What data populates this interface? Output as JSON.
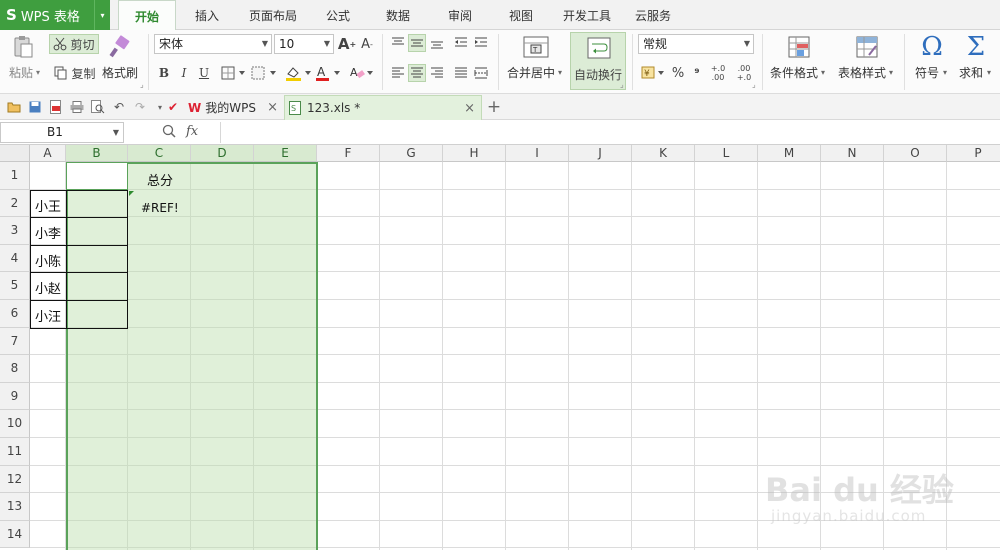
{
  "app": {
    "logo": "S",
    "name": "WPS 表格",
    "drop": "▾"
  },
  "menu_tabs": [
    {
      "label": "开始"
    },
    {
      "label": "插入"
    },
    {
      "label": "页面布局"
    },
    {
      "label": "公式"
    },
    {
      "label": "数据"
    },
    {
      "label": "审阅"
    },
    {
      "label": "视图"
    },
    {
      "label": "开发工具"
    },
    {
      "label": "云服务"
    }
  ],
  "ribbon": {
    "paste": "粘贴",
    "cut": "剪切",
    "copy": "复制",
    "format_painter": "格式刷",
    "font_name": "宋体",
    "font_size": "10",
    "bold": "B",
    "italic": "I",
    "underline": "U",
    "merge_center": "合并居中",
    "wrap_text": "自动换行",
    "number_format": "常规",
    "percent": "%",
    "comma": "⁹",
    "decimal_inc": "+.0 .00",
    "decimal_dec": ".00 +.0",
    "conditional_format": "条件格式",
    "table_style": "表格样式",
    "symbol": "符号",
    "sum": "求和"
  },
  "doc_tabs": [
    {
      "label": "我的WPS",
      "close": "×"
    },
    {
      "label": "123.xls *",
      "close": "×"
    }
  ],
  "add_tab": "+",
  "formula_bar": {
    "cell_ref": "B1",
    "fx": "fx",
    "content": ""
  },
  "sheet": {
    "columns": [
      "A",
      "B",
      "C",
      "D",
      "E",
      "F",
      "G",
      "H",
      "I",
      "J",
      "K",
      "L",
      "M",
      "N",
      "O",
      "P"
    ],
    "rows": [
      "1",
      "2",
      "3",
      "4",
      "5",
      "6",
      "7",
      "8",
      "9",
      "10",
      "11",
      "12",
      "13",
      "14"
    ],
    "c1": "总分",
    "c2": "#REF!",
    "names": [
      "小王",
      "小李",
      "小陈",
      "小赵",
      "小汪"
    ]
  },
  "watermark": {
    "brand": "Bai du 经验",
    "url": "jingyan.baidu.com"
  }
}
